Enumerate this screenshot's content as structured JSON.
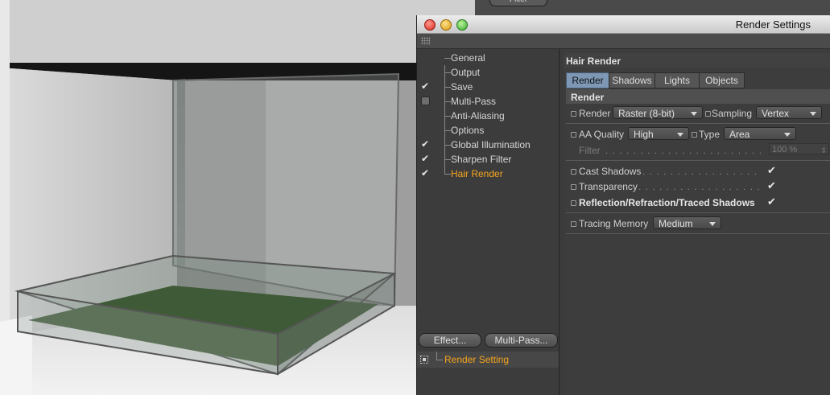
{
  "window": {
    "title": "Render Settings"
  },
  "background": {
    "partial_button": "Filter"
  },
  "left_list": {
    "items": [
      {
        "label": "General",
        "check": "none"
      },
      {
        "label": "Output",
        "check": "none"
      },
      {
        "label": "Save",
        "check": "checked"
      },
      {
        "label": "Multi-Pass",
        "check": "box"
      },
      {
        "label": "Anti-Aliasing",
        "check": "none"
      },
      {
        "label": "Options",
        "check": "none"
      },
      {
        "label": "Global Illumination",
        "check": "checked"
      },
      {
        "label": "Sharpen Filter",
        "check": "checked"
      },
      {
        "label": "Hair Render",
        "check": "checked",
        "active": true
      }
    ],
    "effect_button": "Effect...",
    "multipass_button": "Multi-Pass...",
    "render_setting": "Render Setting"
  },
  "panel": {
    "title": "Hair Render",
    "tabs": [
      "Render",
      "Shadows",
      "Lights",
      "Objects"
    ],
    "active_tab": "Render",
    "section": "Render",
    "render_label": "Render",
    "render_value": "Raster (8-bit)",
    "sampling_label": "Sampling",
    "sampling_value": "Vertex",
    "aa_label": "AA Quality",
    "aa_value": "High",
    "type_label": "Type",
    "type_value": "Area",
    "filter_label": "Filter",
    "filter_value": "100 %",
    "cast_shadows_label": "Cast Shadows",
    "transparency_label": "Transparency",
    "reflection_label": "Reflection/Refraction/Traced Shadows",
    "tracing_label": "Tracing Memory",
    "tracing_value": "Medium"
  },
  "colors": {
    "accent": "#f7a51f",
    "tab_active": "#7d97b5"
  },
  "check_glyph": "✔"
}
